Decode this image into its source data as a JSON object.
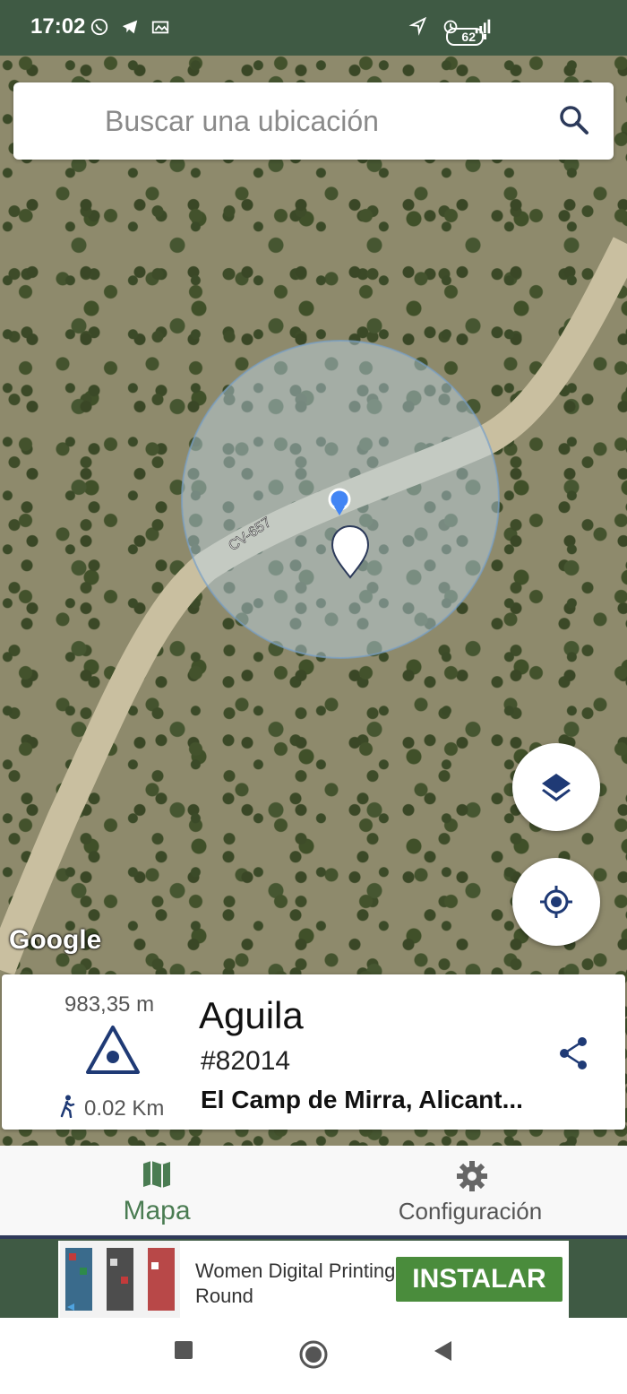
{
  "status_bar": {
    "time": "17:02",
    "battery": "62",
    "left_icons": [
      "whatsapp-icon",
      "telegram-icon",
      "photo-icon"
    ],
    "right_icons": [
      "location-arrow-icon",
      "alarm-icon",
      "signal-icon"
    ]
  },
  "search": {
    "placeholder": "Buscar una ubicación"
  },
  "map": {
    "road_label": "CV-657",
    "attribution": "Google",
    "accent": "#4285f4"
  },
  "info_card": {
    "elevation": "983,35 m",
    "walk_distance": "0.02 Km",
    "name": "Aguila",
    "id": "#82014",
    "location": "El Camp de Mirra, Alicant..."
  },
  "bottom_nav": {
    "items": [
      {
        "label": "Mapa",
        "icon": "map-icon",
        "active": true
      },
      {
        "label": "Configuración",
        "icon": "gear-icon",
        "active": false
      }
    ],
    "active_color": "#4a7c52"
  },
  "ad": {
    "title": "Women Digital Printing Round",
    "cta": "INSTALAR"
  },
  "colors": {
    "brand": "#3f5a44",
    "nav_icon": "#1f3a75"
  }
}
